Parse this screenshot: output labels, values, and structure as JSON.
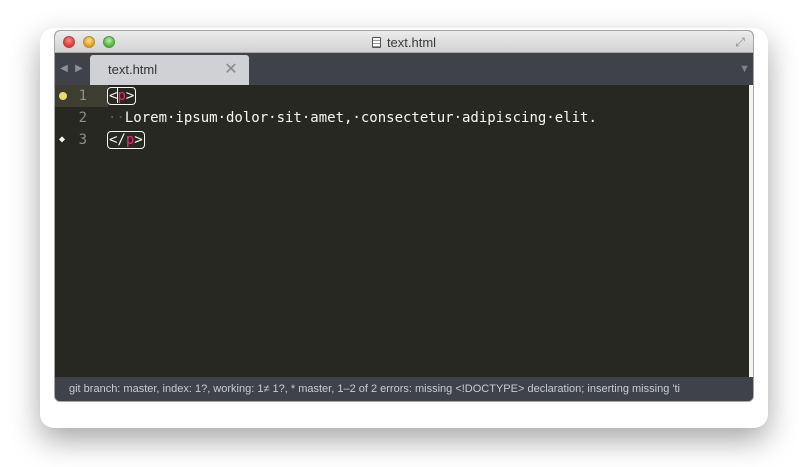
{
  "window": {
    "title": "text.html",
    "title_icon": "document-icon",
    "fullscreen_icon": "fullscreen-icon"
  },
  "tabs": [
    {
      "label": "text.html",
      "active": true,
      "close_icon": "close-icon"
    }
  ],
  "tab_nav": {
    "left": "◀",
    "right": "▶",
    "menu": "▼"
  },
  "editor": {
    "lines": [
      {
        "number": "1",
        "gutter_icon": "modified-dot-icon",
        "current": true
      },
      {
        "number": "2",
        "gutter_icon": null
      },
      {
        "number": "3",
        "gutter_icon": "tag-icon"
      }
    ],
    "line1": {
      "open": "<",
      "tag": "p",
      "close": ">"
    },
    "line2": {
      "indent": "··",
      "text": "Lorem·ipsum·dolor·sit·amet,·consectetur·adipiscing·elit."
    },
    "line3": {
      "open": "</",
      "tag": "p",
      "close": ">"
    }
  },
  "status_bar": {
    "text": "git branch: master, index: 1?, working: 1≠ 1?, * master, 1–2 of 2 errors: missing <!DOCTYPE> declaration; inserting missing 'ti"
  },
  "colors": {
    "editor_bg": "#272822",
    "foreground": "#f8f8f2",
    "tag": "#f92672",
    "gutter_dot": "#e6db74",
    "chrome": "#3f4249"
  }
}
